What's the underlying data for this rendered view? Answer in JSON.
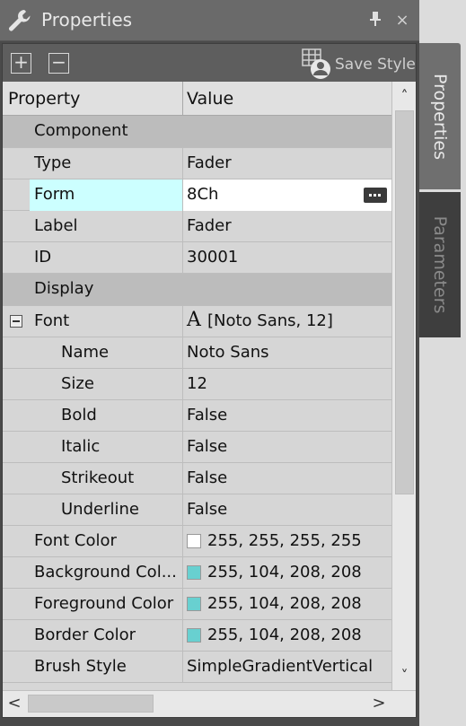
{
  "window": {
    "title": "Properties",
    "pin_glyph": "↑",
    "close_glyph": "×"
  },
  "toolbar": {
    "expand_all_glyph": "+",
    "collapse_all_glyph": "−",
    "save_style_label": "Save Style"
  },
  "grid": {
    "header": {
      "property": "Property",
      "value": "Value"
    },
    "rows": [
      {
        "kind": "category",
        "name": "Component"
      },
      {
        "kind": "prop",
        "name": "Type",
        "value": "Fader"
      },
      {
        "kind": "prop",
        "name": "Form",
        "value": "8Ch",
        "selected": true,
        "editor": "ellipsis-button"
      },
      {
        "kind": "prop",
        "name": "Label",
        "value": "Fader"
      },
      {
        "kind": "prop",
        "name": "ID",
        "value": "30001"
      },
      {
        "kind": "category",
        "name": "Display"
      },
      {
        "kind": "prop",
        "name": "Font",
        "value": "[Noto Sans, 12]",
        "glyph": "A",
        "expanded": true
      },
      {
        "kind": "sub",
        "name": "Name",
        "value": "Noto Sans"
      },
      {
        "kind": "sub",
        "name": "Size",
        "value": "12"
      },
      {
        "kind": "sub",
        "name": "Bold",
        "value": "False"
      },
      {
        "kind": "sub",
        "name": "Italic",
        "value": "False"
      },
      {
        "kind": "sub",
        "name": "Strikeout",
        "value": "False"
      },
      {
        "kind": "sub",
        "name": "Underline",
        "value": "False"
      },
      {
        "kind": "prop",
        "name": "Font Color",
        "value": "255, 255, 255, 255",
        "swatch": "#ffffff"
      },
      {
        "kind": "prop",
        "name": "Background Col...",
        "value": "255, 104, 208, 208",
        "swatch": "#68d0d0"
      },
      {
        "kind": "prop",
        "name": "Foreground Color",
        "value": "255, 104, 208, 208",
        "swatch": "#68d0d0"
      },
      {
        "kind": "prop",
        "name": "Border Color",
        "value": "255, 104, 208, 208",
        "swatch": "#68d0d0"
      },
      {
        "kind": "prop",
        "name": "Brush Style",
        "value": "SimpleGradientVertical"
      }
    ]
  },
  "scrollbars": {
    "up_glyph": "˄",
    "down_glyph": "˅",
    "left_glyph": "<",
    "right_glyph": ">"
  },
  "side_tabs": [
    {
      "label": "Properties",
      "active": true
    },
    {
      "label": "Parameters",
      "active": false
    }
  ],
  "colors": {
    "selected_name_bg": "#ccffff",
    "swatch_teal": "#68d0d0"
  }
}
